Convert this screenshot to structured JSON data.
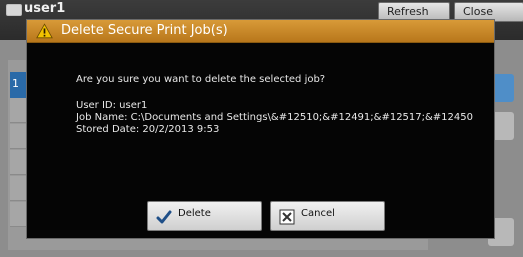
{
  "background": {
    "user": "user1",
    "refresh_label": "Refresh",
    "close_label": "Close",
    "selected_row_number": "1"
  },
  "dialog": {
    "title": "Delete Secure Print Job(s)",
    "question": "Are you sure you want to delete the selected job?",
    "user_id_line": "User ID: user1",
    "job_name_line": "Job Name: C:\\Documents and Settings\\&#12510;&#12491;&#12517;&#12450",
    "stored_date_line": "Stored Date: 20/2/2013 9:53",
    "delete_label": "Delete",
    "cancel_label": "Cancel",
    "icons": {
      "title": "warning-icon",
      "delete": "checkmark-icon",
      "cancel": "x-box-icon"
    },
    "colors": {
      "title_bar": "#c8871f",
      "dialog_background": "#050505",
      "selected_row": "#2a6aa8"
    }
  }
}
